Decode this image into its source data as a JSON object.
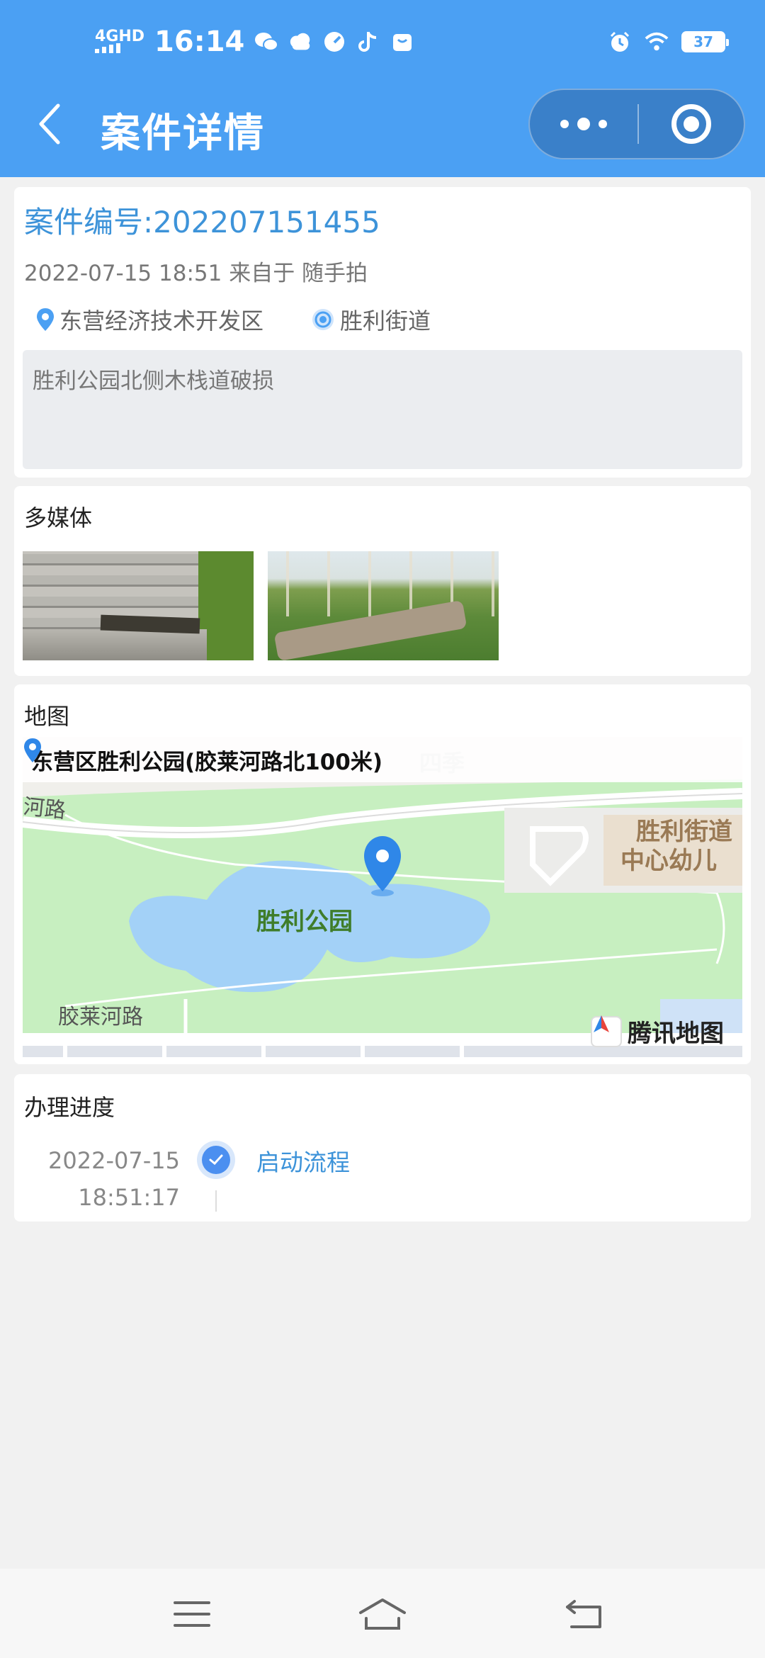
{
  "status_bar": {
    "network": "4GHD",
    "time": "16:14",
    "battery": "37"
  },
  "header": {
    "title": "案件详情"
  },
  "case": {
    "number": "案件编号:202207151455",
    "meta": "2022-07-15 18:51 来自于 随手拍",
    "district": "东营经济技术开发区",
    "street": "胜利街道",
    "description": "胜利公园北侧木栈道破损"
  },
  "media": {
    "title": "多媒体"
  },
  "map": {
    "title": "地图",
    "address": "东营区胜利公园(胶莱河路北100米)",
    "labels": {
      "park": "胜利公园",
      "road_top": "河路",
      "road_bottom": "胶莱河路",
      "school_line1": "胜利街道",
      "school_line2": "中心幼儿",
      "faded": "四季"
    },
    "brand": "腾讯地图"
  },
  "progress": {
    "title": "办理进度",
    "steps": [
      {
        "date": "2022-07-15",
        "time": "18:51:17",
        "label": "启动流程"
      }
    ]
  }
}
